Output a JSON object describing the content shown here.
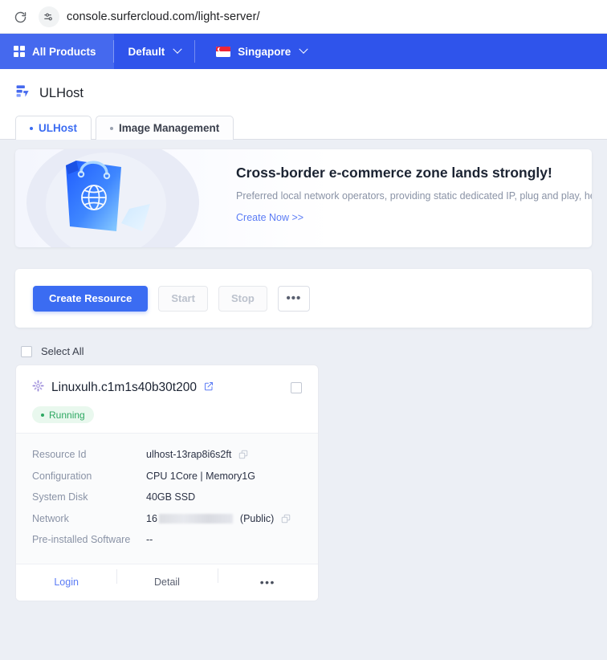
{
  "browser": {
    "reload_icon": "reload-icon",
    "site_settings_icon": "site-settings-icon",
    "url": "console.surfercloud.com/light-server/"
  },
  "topnav": {
    "all_products": "All Products",
    "project": "Default",
    "region": "Singapore",
    "grid_icon": "grid-icon",
    "flag_icon": "singapore-flag-icon",
    "caret_icon": "chevron-down-icon",
    "background_color": "#2f54eb"
  },
  "header": {
    "title": "ULHost",
    "title_icon": "ulhost-server-icon",
    "tabs": [
      {
        "label": "ULHost",
        "active": true
      },
      {
        "label": "Image Management",
        "active": false
      }
    ]
  },
  "banner": {
    "title": "Cross-border e-commerce zone lands strongly!",
    "subtitle": "Preferred local network operators, providing static dedicated IP, plug and play, helpi",
    "link": "Create Now >>",
    "art_icon": "shopping-bag-globe-illustration"
  },
  "toolbar": {
    "create_label": "Create Resource",
    "start_label": "Start",
    "stop_label": "Stop",
    "more_label": "•••"
  },
  "list": {
    "select_all_label": "Select All"
  },
  "resource": {
    "name": "Linuxulh.c1m1s40b30t200",
    "name_icon": "gear-icon",
    "edit_icon": "edit-icon",
    "checkbox_icon": "checkbox-icon",
    "status": "Running",
    "status_color": "#2ea862",
    "rows": [
      {
        "key": "Resource Id",
        "value": "ulhost-13rap8i6s2ft",
        "copy": true,
        "redacted": false
      },
      {
        "key": "Configuration",
        "value": "CPU 1Core  |  Memory1G",
        "copy": false,
        "redacted": false
      },
      {
        "key": "System Disk",
        "value": "40GB SSD",
        "copy": false,
        "redacted": false
      },
      {
        "key": "Network",
        "value": "16",
        "suffix": "(Public)",
        "copy": true,
        "redacted": true
      },
      {
        "key": "Pre-installed Software",
        "value": "--",
        "copy": false,
        "redacted": false
      }
    ],
    "actions": {
      "login": "Login",
      "detail": "Detail",
      "more": "•••"
    }
  }
}
